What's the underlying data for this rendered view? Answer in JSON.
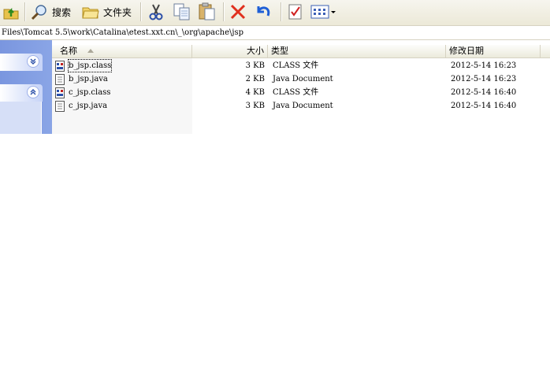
{
  "toolbar": {
    "search_label": "搜索",
    "folders_label": "文件夹"
  },
  "address": {
    "path": "Files\\Tomcat 5.5\\work\\Catalina\\etest.xxt.cn\\_\\org\\apache\\jsp"
  },
  "columns": {
    "name": "名称",
    "size": "大小",
    "type": "类型",
    "modified": "修改日期"
  },
  "files": [
    {
      "name": "b_jsp.class",
      "size": "3 KB",
      "type": "CLASS 文件",
      "modified": "2012-5-14 16:23",
      "icon": "class-file-icon"
    },
    {
      "name": "b_jsp.java",
      "size": "2 KB",
      "type": "Java Document",
      "modified": "2012-5-14 16:23",
      "icon": "java-file-icon"
    },
    {
      "name": "c_jsp.class",
      "size": "4 KB",
      "type": "CLASS 文件",
      "modified": "2012-5-14 16:40",
      "icon": "class-file-icon"
    },
    {
      "name": "c_jsp.java",
      "size": "3 KB",
      "type": "Java Document",
      "modified": "2012-5-14 16:40",
      "icon": "java-file-icon"
    }
  ],
  "colors": {
    "taskpane": "#7a96df",
    "delete": "#e0301e",
    "undo": "#1f5fd6"
  }
}
